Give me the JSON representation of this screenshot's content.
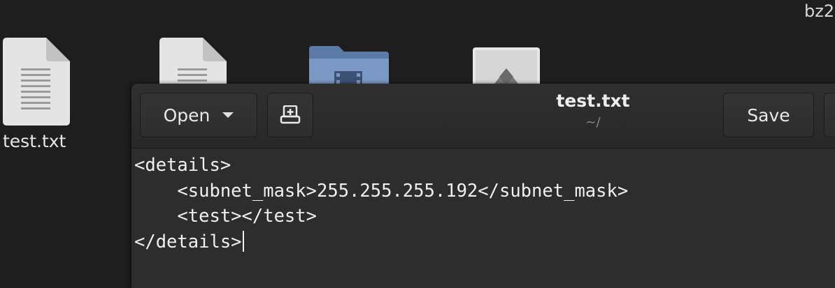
{
  "desktop": {
    "top_label": "bz2",
    "icons": [
      {
        "name": "text-file-icon",
        "caption": "test.txt"
      },
      {
        "name": "text-file-icon",
        "caption": ""
      },
      {
        "name": "video-folder-icon",
        "caption": ""
      },
      {
        "name": "image-file-icon",
        "caption": ""
      }
    ]
  },
  "editor": {
    "open_label": "Open",
    "new_tab_icon": "new-document-icon",
    "title": "test.txt",
    "subtitle": "~/",
    "save_label": "Save",
    "lines": [
      "<details>",
      "    <subnet_mask>255.255.255.192</subnet_mask>",
      "    <test></test>",
      "</details>"
    ]
  },
  "colors": {
    "background": "#1e1e1e",
    "headerbar": "#2c2c2c",
    "text": "#f0f0f0",
    "folder": "#6f8fb8"
  }
}
